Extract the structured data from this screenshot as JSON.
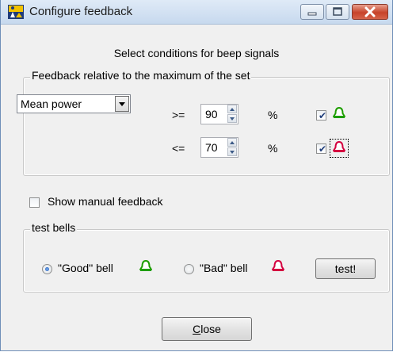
{
  "window": {
    "title": "Configure feedback",
    "colors": {
      "good_bell": "#22aa00",
      "bad_bell": "#dd0044"
    }
  },
  "heading": "Select conditions for beep signals",
  "relative_group": {
    "legend": "Feedback relative to the maximum of the set",
    "measure": {
      "selected": "Mean power"
    },
    "upper": {
      "operator": ">=",
      "value": "90",
      "unit": "%",
      "checked": true,
      "bell": "good-bell-icon"
    },
    "lower": {
      "operator": "<=",
      "value": "70",
      "unit": "%",
      "checked": true,
      "bell": "bad-bell-icon"
    }
  },
  "manual_feedback": {
    "label": "Show manual feedback",
    "checked": false
  },
  "test_group": {
    "legend": "test bells",
    "good_option": {
      "label": "\"Good\" bell",
      "selected": true
    },
    "bad_option": {
      "label": "\"Bad\" bell",
      "selected": false
    },
    "test_button": "test!"
  },
  "close_button": {
    "prefix": "C",
    "rest": "lose"
  }
}
